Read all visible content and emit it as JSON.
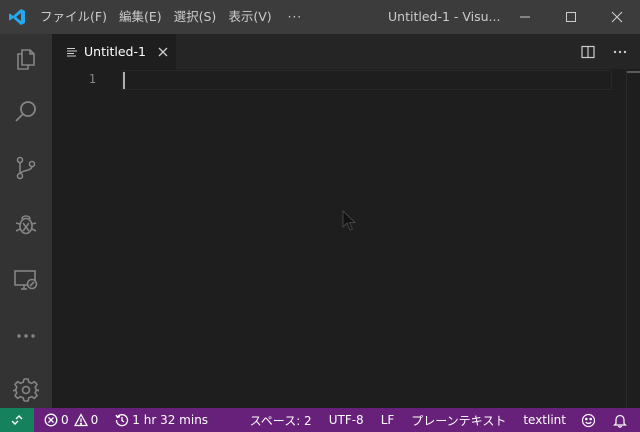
{
  "titlebar": {
    "menus": [
      "ファイル(F)",
      "編集(E)",
      "選択(S)",
      "表示(V)"
    ],
    "more": "···",
    "window_title": "Untitled-1 - Visu..."
  },
  "activitybar": {
    "icons": [
      "explorer-icon",
      "search-icon",
      "source-control-icon",
      "debug-icon",
      "remote-explorer-icon",
      "more-icon",
      "settings-gear-icon"
    ]
  },
  "tab": {
    "label": "Untitled-1",
    "close_glyph": "×"
  },
  "editor": {
    "line_numbers": [
      "1"
    ],
    "content": ""
  },
  "statusbar": {
    "errors": "0",
    "warnings": "0",
    "time": "1 hr 32 mins",
    "indent": "スペース: 2",
    "encoding": "UTF-8",
    "eol": "LF",
    "language": "プレーンテキスト",
    "linter": "textlint"
  },
  "colors": {
    "statusbar": "#68217a",
    "remote": "#16825d",
    "accent_logo": "#23a9f2",
    "titlebar": "#3c3c3c",
    "activitybar": "#333333",
    "editor": "#1e1e1e"
  }
}
